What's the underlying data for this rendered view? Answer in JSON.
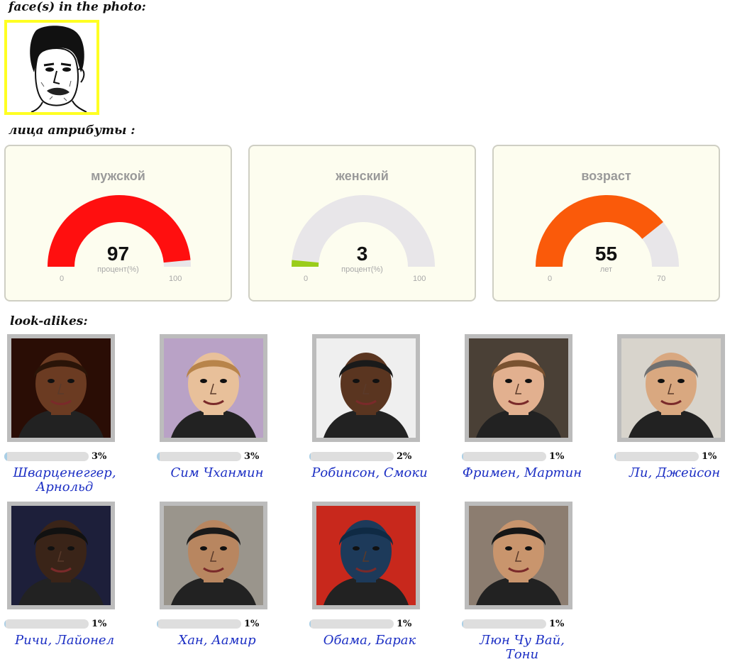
{
  "faces_section": {
    "title": "face(s) in the photo:"
  },
  "attributes_section": {
    "title": "лица атрибуты :"
  },
  "gauges": [
    {
      "title": "мужской",
      "value": "97",
      "unit": "процент(%)",
      "min": "0",
      "max": "100",
      "fraction": 0.97,
      "color": "#ff0f0f"
    },
    {
      "title": "женский",
      "value": "3",
      "unit": "процент(%)",
      "min": "0",
      "max": "100",
      "fraction": 0.03,
      "color": "#9acd1a"
    },
    {
      "title": "возраст",
      "value": "55",
      "unit": "лет",
      "min": "0",
      "max": "70",
      "fraction": 0.7857,
      "color": "#fa5a0a"
    }
  ],
  "lookalikes_section": {
    "title": "look-alikes:"
  },
  "lookalikes": [
    {
      "name": "Шварценеггер, Арнольд",
      "percent": "3%",
      "fraction": 0.03
    },
    {
      "name": "Сим Чханмин",
      "percent": "3%",
      "fraction": 0.03
    },
    {
      "name": "Робинсон, Смоки",
      "percent": "2%",
      "fraction": 0.02
    },
    {
      "name": "Фримен, Мартин",
      "percent": "1%",
      "fraction": 0.01
    },
    {
      "name": "Ли, Джейсон",
      "percent": "1%",
      "fraction": 0.01
    },
    {
      "name": "Ричи, Лайонел",
      "percent": "1%",
      "fraction": 0.01
    },
    {
      "name": "Хан, Аамир",
      "percent": "1%",
      "fraction": 0.01
    },
    {
      "name": "Обама, Барак",
      "percent": "1%",
      "fraction": 0.01
    },
    {
      "name": "Люн Чу Вай, Тони",
      "percent": "1%",
      "fraction": 0.01
    }
  ],
  "colors": {
    "gauge_track": "#e8e6e9",
    "name_link": "#1c2fc4",
    "face_border": "#ffff22"
  }
}
